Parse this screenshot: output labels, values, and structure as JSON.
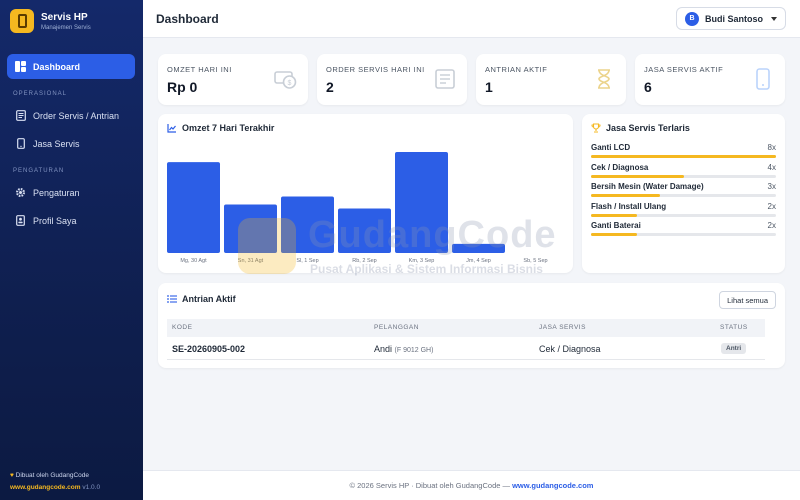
{
  "brand": {
    "title": "Servis HP",
    "subtitle": "Manajemen Servis"
  },
  "sidebar": {
    "active_item": "Dashboard",
    "section_ops": "OPERASIONAL",
    "item_orders": "Order Servis / Antrian",
    "item_services": "Jasa Servis",
    "section_settings": "PENGATURAN",
    "item_settings": "Pengaturan",
    "item_profile": "Profil Saya",
    "credit": "Dibuat oleh GudangCode",
    "credit_link": "www.gudangcode.com",
    "version": "v1.0.0"
  },
  "header": {
    "title": "Dashboard",
    "user_initial": "B",
    "user_name": "Budi Santoso"
  },
  "stats": [
    {
      "label": "OMZET HARI INI",
      "value": "Rp 0",
      "icon": "money-icon"
    },
    {
      "label": "ORDER SERVIS HARI INI",
      "value": "2",
      "icon": "receipt-icon"
    },
    {
      "label": "ANTRIAN AKTIF",
      "value": "1",
      "icon": "hourglass-icon"
    },
    {
      "label": "JASA SERVIS AKTIF",
      "value": "6",
      "icon": "phone-icon"
    }
  ],
  "revenue_card": {
    "title": "Omzet 7 Hari Terakhir"
  },
  "chart_data": {
    "type": "bar",
    "categories": [
      "Mg, 30 Agt",
      "Sn, 31 Agt",
      "Sl, 1 Sep",
      "Rb, 2 Sep",
      "Km, 3 Sep",
      "Jm, 4 Sep",
      "Sb, 5 Sep"
    ],
    "values": [
      90,
      48,
      56,
      44,
      100,
      9,
      0
    ],
    "ylim": [
      0,
      100
    ],
    "grid": false,
    "color": "#2c5ee6"
  },
  "top_services": {
    "title": "Jasa Servis Terlaris",
    "items": [
      {
        "name": "Ganti LCD",
        "count": "8x",
        "ratio": 1.0
      },
      {
        "name": "Cek / Diagnosa",
        "count": "4x",
        "ratio": 0.5
      },
      {
        "name": "Bersih Mesin (Water Damage)",
        "count": "3x",
        "ratio": 0.375
      },
      {
        "name": "Flash / Install Ulang",
        "count": "2x",
        "ratio": 0.25
      },
      {
        "name": "Ganti Baterai",
        "count": "2x",
        "ratio": 0.25
      }
    ]
  },
  "queue": {
    "title": "Antrian Aktif",
    "see_all": "Lihat semua",
    "columns": {
      "code": "KODE",
      "customer": "PELANGGAN",
      "service": "JASA SERVIS",
      "status": "STATUS"
    },
    "rows": [
      {
        "code": "SE-20260905-002",
        "customer": "Andi",
        "plate": "(F 9012 GH)",
        "service": "Cek / Diagnosa",
        "status": "Antri"
      }
    ]
  },
  "watermark": {
    "title": "GudangCode",
    "subtitle": "Pusat Aplikasi & Sistem Informasi Bisnis"
  },
  "footer": {
    "text": "© 2026 Servis HP · Dibuat oleh GudangCode — ",
    "link": "www.gudangcode.com"
  },
  "colors": {
    "primary": "#2c5ee6",
    "accent": "#f5b820",
    "sidebar": "#14296a"
  }
}
